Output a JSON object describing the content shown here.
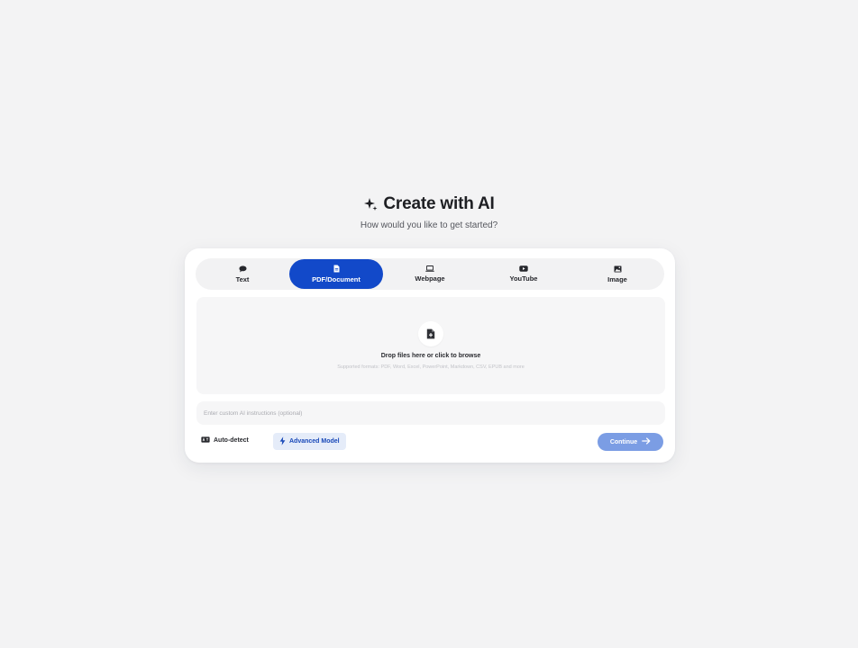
{
  "header": {
    "title": "Create with AI",
    "subtitle": "How would you like to get started?",
    "title_icon": "sparkle-icon"
  },
  "tabs": [
    {
      "label": "Text",
      "icon": "chat-bubble-icon",
      "active": false
    },
    {
      "label": "PDF/Document",
      "icon": "document-icon",
      "active": true
    },
    {
      "label": "Webpage",
      "icon": "laptop-icon",
      "active": false
    },
    {
      "label": "YouTube",
      "icon": "youtube-icon",
      "active": false
    },
    {
      "label": "Image",
      "icon": "image-icon",
      "active": false
    }
  ],
  "dropzone": {
    "title": "Drop files here or click to browse",
    "formats": "Supported formats: PDF, Word, Excel, PowerPoint, Markdown, CSV, EPUB and more",
    "icon": "file-upload-icon"
  },
  "instructions": {
    "placeholder": "Enter custom AI instructions (optional)",
    "value": ""
  },
  "footer": {
    "autodetect_label": "Auto-detect",
    "autodetect_icon": "language-icon",
    "advanced_label": "Advanced Model",
    "advanced_icon": "lightning-icon",
    "continue_label": "Continue",
    "continue_icon": "arrow-right-icon"
  },
  "colors": {
    "background": "#f3f3f4",
    "accent": "#1249c9",
    "continue_disabled": "#7b9de4",
    "advanced_bg": "#e5ecf9"
  }
}
